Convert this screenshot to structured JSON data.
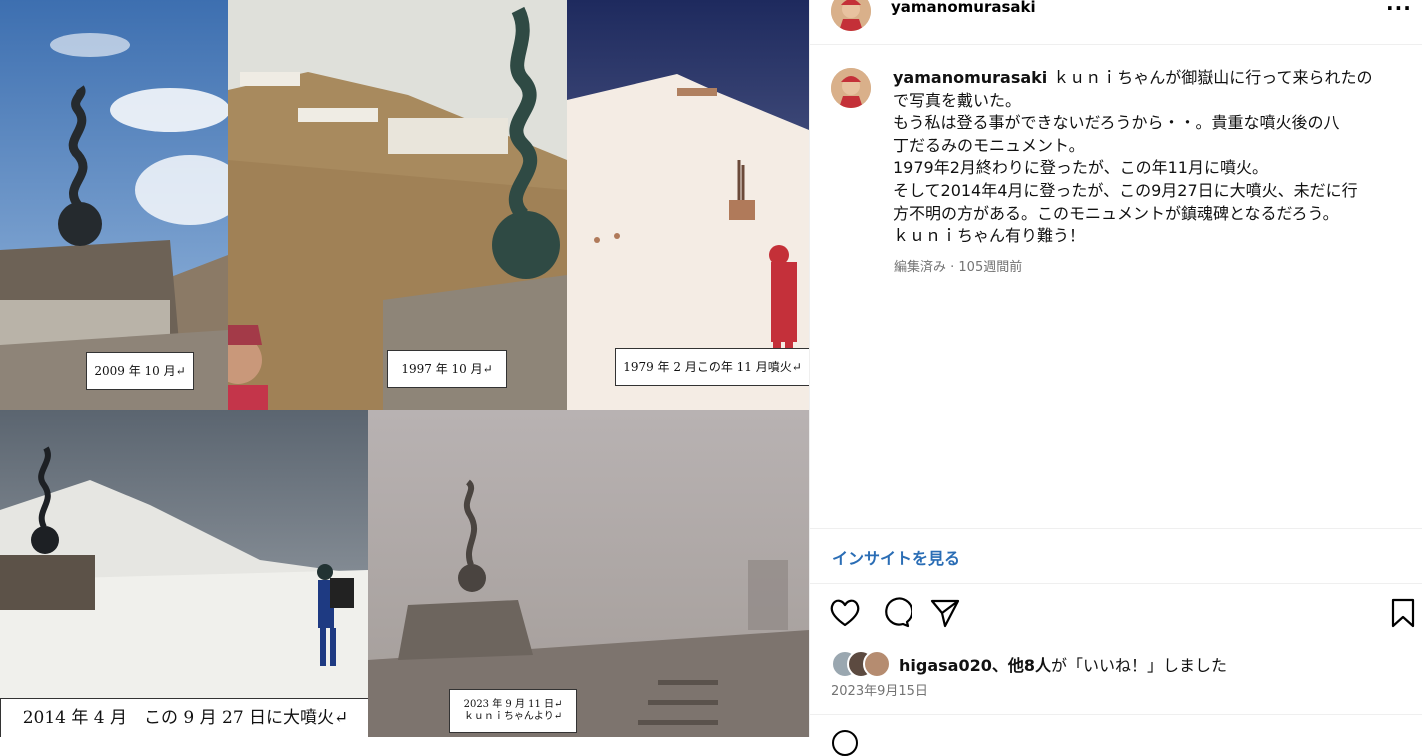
{
  "post": {
    "username": "yamanomurasaki",
    "more_label": "···",
    "caption_lines": [
      "ｋｕｎｉちゃんが御嶽山に行って来られたの",
      "で写真を戴いた。",
      "もう私は登る事ができないだろうから・・。貴重な噴火後の八",
      "丁だるみのモニュメント。",
      "1979年2月終わりに登ったが、この年11月に噴火。",
      "そして2014年4月に登ったが、この9月27日に大噴火、未だに行",
      "方不明の方がある。このモニュメントが鎮魂碑となるだろう。",
      "ｋｕｎｉちゃん有り難う！"
    ],
    "meta": "編集済み · 105週間前",
    "insight_label": "インサイトを見る",
    "likes": {
      "user": "higasa020",
      "rest_bold": "、他8人",
      "suffix": "が「いいね！」しました"
    },
    "date": "2023年9月15日"
  },
  "collage": {
    "captions": [
      {
        "id": "c2009",
        "lines": [
          "2009 年 10 月↵"
        ]
      },
      {
        "id": "c1997",
        "lines": [
          "1997 年 10 月↵"
        ]
      },
      {
        "id": "c1979",
        "lines": [
          "1979 年 2 月この年 11 月噴火↵"
        ]
      },
      {
        "id": "c2014",
        "lines": [
          "2014 年 4 月　この 9 月 27 日に大噴火↵"
        ]
      },
      {
        "id": "c2023",
        "lines": [
          "2023 年 9 月 11 日↵",
          "ｋｕｎｉちゃんより↵"
        ]
      }
    ]
  },
  "icons": {
    "like": "heart-icon",
    "comment": "comment-icon",
    "share": "paper-plane-icon",
    "save": "bookmark-icon",
    "more": "more-icon"
  },
  "colors": {
    "link": "#2a6db5",
    "meta": "#737373",
    "divider": "#efefef"
  }
}
